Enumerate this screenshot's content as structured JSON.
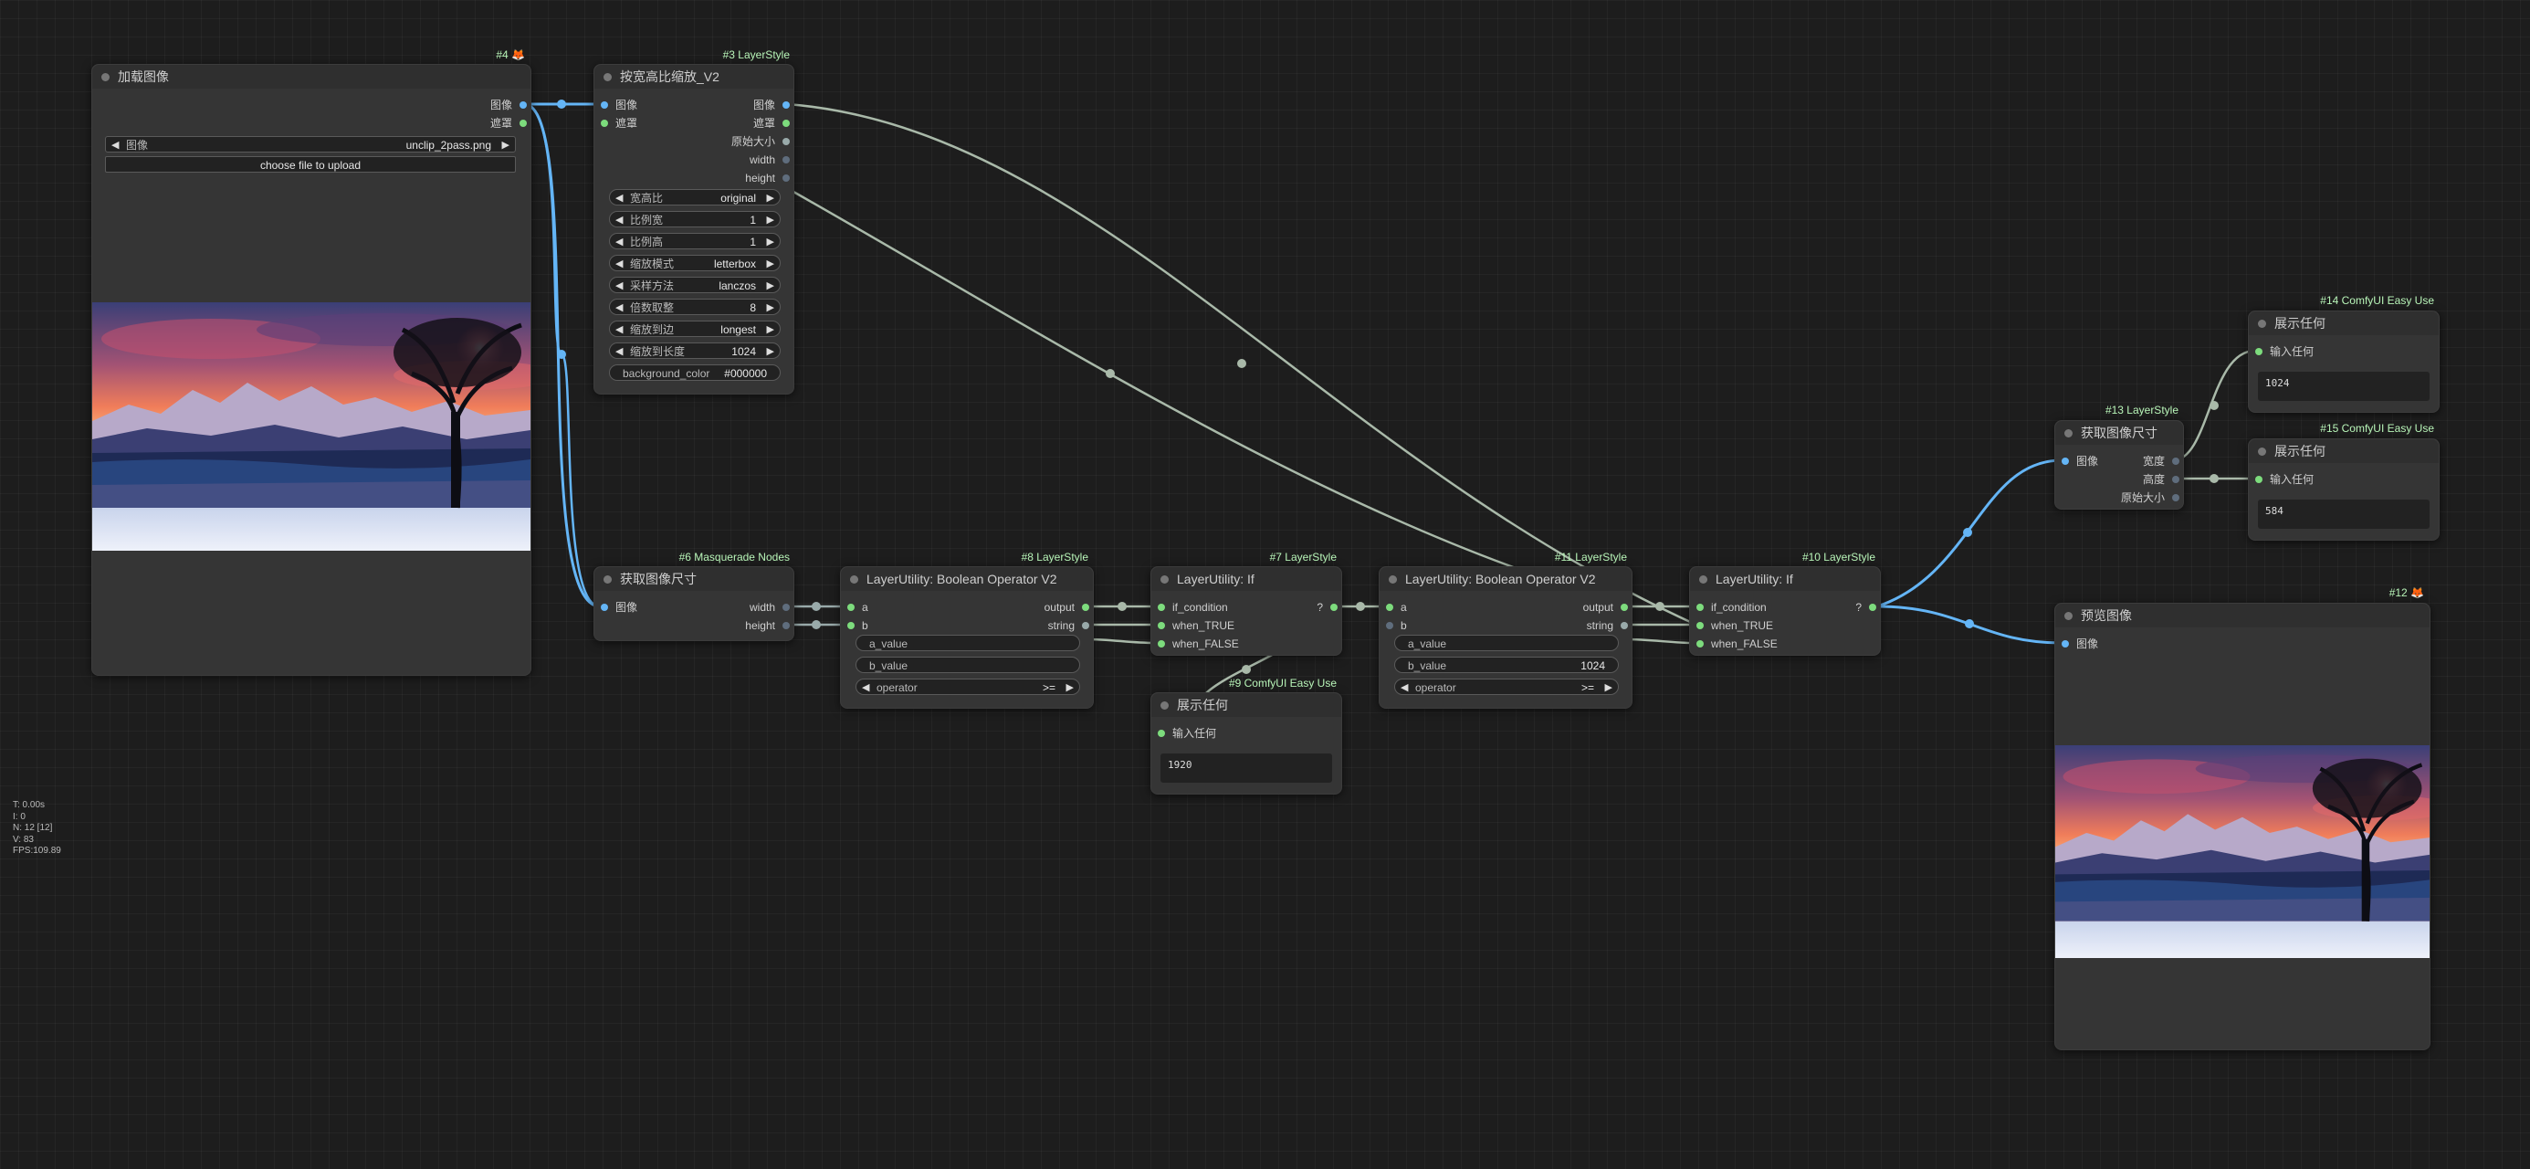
{
  "nodes": {
    "n4": {
      "id": "#4 🦊",
      "title": "加载图像",
      "out_image": "图像",
      "out_mask": "遮罩",
      "image_label": "图像",
      "image_value": "unclip_2pass.png",
      "upload": "choose file to upload"
    },
    "n3": {
      "id": "#3 LayerStyle",
      "title": "按宽高比缩放_V2",
      "in_image": "图像",
      "in_mask": "遮罩",
      "out_image": "图像",
      "out_mask": "遮罩",
      "out_orig": "原始大小",
      "out_width": "width",
      "out_height": "height",
      "widgets": [
        {
          "label": "宽高比",
          "value": "original"
        },
        {
          "label": "比例宽",
          "value": "1"
        },
        {
          "label": "比例高",
          "value": "1"
        },
        {
          "label": "缩放模式",
          "value": "letterbox"
        },
        {
          "label": "采样方法",
          "value": "lanczos"
        },
        {
          "label": "倍数取整",
          "value": "8"
        },
        {
          "label": "缩放到边",
          "value": "longest"
        },
        {
          "label": "缩放到长度",
          "value": "1024"
        }
      ],
      "bg_label": "background_color",
      "bg_value": "#000000"
    },
    "n6": {
      "id": "#6 Masquerade Nodes",
      "title": "获取图像尺寸",
      "in_image": "图像",
      "out_width": "width",
      "out_height": "height"
    },
    "n8": {
      "id": "#8 LayerStyle",
      "title": "LayerUtility: Boolean Operator V2",
      "in_a": "a",
      "in_b": "b",
      "out_output": "output",
      "out_string": "string",
      "a_value": "a_value",
      "b_value": "b_value",
      "operator_label": "operator",
      "operator_value": ">="
    },
    "n7": {
      "id": "#7 LayerStyle",
      "title": "LayerUtility: If",
      "in_cond": "if_condition",
      "in_true": "when_TRUE",
      "in_false": "when_FALSE",
      "out": "?"
    },
    "n9": {
      "id": "#9 ComfyUI Easy Use",
      "title": "展示任何",
      "in_any": "输入任何",
      "text": "1920"
    },
    "n11": {
      "id": "#11 LayerStyle",
      "title": "LayerUtility: Boolean Operator V2",
      "in_a": "a",
      "in_b": "b",
      "out_output": "output",
      "out_string": "string",
      "a_value": "a_value",
      "b_value_label": "b_value",
      "b_value": "1024",
      "operator_label": "operator",
      "operator_value": ">="
    },
    "n10": {
      "id": "#10 LayerStyle",
      "title": "LayerUtility: If",
      "in_cond": "if_condition",
      "in_true": "when_TRUE",
      "in_false": "when_FALSE",
      "out": "?"
    },
    "n13": {
      "id": "#13 LayerStyle",
      "title": "获取图像尺寸",
      "in_image": "图像",
      "out_w": "宽度",
      "out_h": "高度",
      "out_orig": "原始大小"
    },
    "n14": {
      "id": "#14 ComfyUI Easy Use",
      "title": "展示任何",
      "in_any": "输入任何",
      "text": "1024"
    },
    "n15": {
      "id": "#15 ComfyUI Easy Use",
      "title": "展示任何",
      "in_any": "输入任何",
      "text": "584"
    },
    "n12": {
      "id": "#12 🦊",
      "title": "预览图像",
      "in_image": "图像"
    }
  },
  "stats": {
    "t": "T: 0.00s",
    "i": "I: 0",
    "n": "N: 12 [12]",
    "v": "V: 83",
    "fps": "FPS:109.89"
  },
  "colors": {
    "image_wire": "#64b5f6",
    "generic_wire": "#a9b9a9",
    "number_wire": "#9aa",
    "canvas": "#1d1d1d",
    "node": "#353535"
  }
}
